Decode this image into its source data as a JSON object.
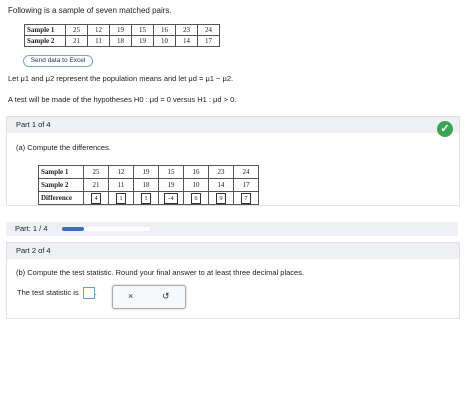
{
  "intro": "Following is a sample of seven matched pairs.",
  "table1": {
    "row1_label": "Sample 1",
    "row2_label": "Sample 2",
    "sample1": [
      "25",
      "12",
      "19",
      "15",
      "16",
      "23",
      "24"
    ],
    "sample2": [
      "21",
      "11",
      "18",
      "19",
      "10",
      "14",
      "17"
    ]
  },
  "excel_button": "Send data to Excel",
  "line1": "Let μ1 and μ2 represent the population means and let μd = μ1 − μ2.",
  "line2": "A test will be made of the hypotheses H0 : μd = 0 versus H1 : μd > 0.",
  "part1": {
    "header": "Part 1 of 4",
    "prompt": "(a) Compute the differences.",
    "row1_label": "Sample 1",
    "row2_label": "Sample 2",
    "row3_label": "Difference",
    "sample1": [
      "25",
      "12",
      "19",
      "15",
      "16",
      "23",
      "24"
    ],
    "sample2": [
      "21",
      "11",
      "18",
      "19",
      "10",
      "14",
      "17"
    ],
    "differences": [
      "4",
      "1",
      "1",
      "-4",
      "6",
      "9",
      "7"
    ],
    "status_color": "#3aa655"
  },
  "progress": {
    "label": "Part: 1 / 4",
    "fraction": 0.25,
    "color": "#3e6fb0"
  },
  "part2": {
    "header": "Part 2 of 4",
    "prompt": "(b) Compute the test statistic. Round your final answer to at least three decimal places.",
    "answer_label": "The test statistic is",
    "answer_value": "",
    "clear_symbol": "×",
    "undo_symbol": "↺"
  }
}
